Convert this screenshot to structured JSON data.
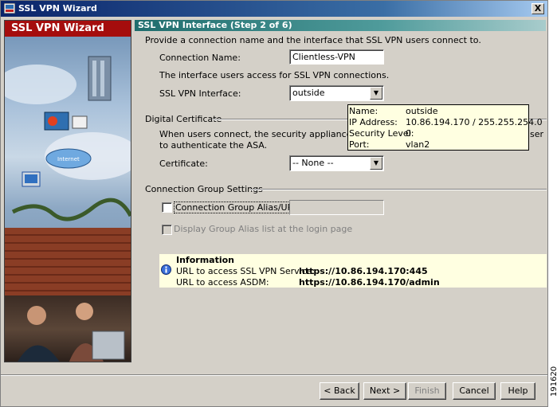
{
  "window": {
    "title": "SSL VPN Wizard",
    "close_label": "X"
  },
  "sidebar": {
    "header": "SSL VPN Wizard",
    "cloud_label": "Internet"
  },
  "step_title": "SSL VPN Interface  (Step 2 of 6)",
  "intro": "Provide a connection name and the interface that SSL VPN users connect to.",
  "connection_name": {
    "label": "Connection Name:",
    "value": "Clientless-VPN"
  },
  "interface_note": "The interface users access for SSL VPN connections.",
  "ssl_interface": {
    "label": "SSL VPN Interface:",
    "value": "outside"
  },
  "tooltip": {
    "name_label": "Name:",
    "name_value": "outside",
    "ip_label": "IP Address:",
    "ip_value": "10.86.194.170 / 255.255.254.0",
    "sec_label": "Security Level:",
    "sec_value": "0",
    "port_label": "Port:",
    "port_value": "vlan2"
  },
  "digital_cert": {
    "group_label": "Digital Certificate",
    "desc_line1_a": "When users connect, the security appliance send",
    "desc_line1_b": "ser",
    "desc_line2": "to authenticate the ASA.",
    "cert_label": "Certificate:",
    "cert_value": "-- None --"
  },
  "connection_group": {
    "group_label": "Connection Group Settings",
    "alias_label": "Connection Group Alias/URL",
    "display_label": "Display Group Alias list at the login page"
  },
  "info": {
    "title": "Information",
    "ssl_label": "URL to access SSL VPN Service:",
    "ssl_url": "https://10.86.194.170:445",
    "asdm_label": "URL to access ASDM:",
    "asdm_url": "https://10.86.194.170/admin"
  },
  "buttons": {
    "back": "< Back",
    "next": "Next >",
    "finish": "Finish",
    "cancel": "Cancel",
    "help": "Help"
  },
  "figure_id": "191620"
}
